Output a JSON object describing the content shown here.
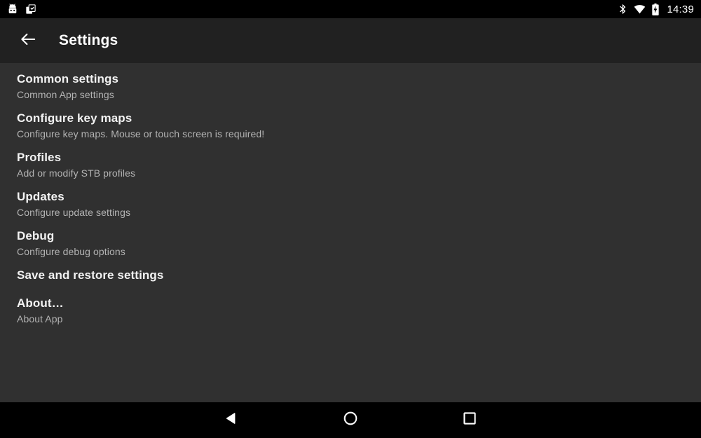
{
  "status_bar": {
    "left_icons": [
      {
        "name": "robot-notification-icon",
        "label": "robot-notification"
      },
      {
        "name": "clipboard-checklist-icon",
        "label": "clipboard-checklist"
      }
    ],
    "right_icons": [
      {
        "name": "bluetooth-icon",
        "label": "bluetooth"
      },
      {
        "name": "wifi-icon",
        "label": "wifi-full-signal"
      },
      {
        "name": "battery-charging-icon",
        "label": "battery-charging"
      }
    ],
    "time": "14:39"
  },
  "app_bar": {
    "back_icon": "back-arrow-icon",
    "title": "Settings"
  },
  "settings": {
    "items": [
      {
        "title": "Common settings",
        "subtitle": "Common App settings"
      },
      {
        "title": "Configure key maps",
        "subtitle": "Configure key maps. Mouse or touch screen is required!"
      },
      {
        "title": "Profiles",
        "subtitle": "Add or modify STB profiles"
      },
      {
        "title": "Updates",
        "subtitle": "Configure update settings"
      },
      {
        "title": "Debug",
        "subtitle": "Configure debug options"
      },
      {
        "title": "Save and restore settings",
        "subtitle": ""
      },
      {
        "title": "About…",
        "subtitle": "About App"
      }
    ]
  },
  "nav_bar": {
    "buttons": [
      {
        "name": "nav-back-button",
        "icon": "triangle-left-icon"
      },
      {
        "name": "nav-home-button",
        "icon": "circle-icon"
      },
      {
        "name": "nav-recents-button",
        "icon": "square-icon"
      }
    ]
  },
  "colors": {
    "status_bar_bg": "#000000",
    "app_bar_bg": "#212121",
    "content_bg": "#303030",
    "nav_bar_bg": "#000000",
    "title_text": "#f2f2f2",
    "subtitle_text": "#b3b3b3"
  }
}
